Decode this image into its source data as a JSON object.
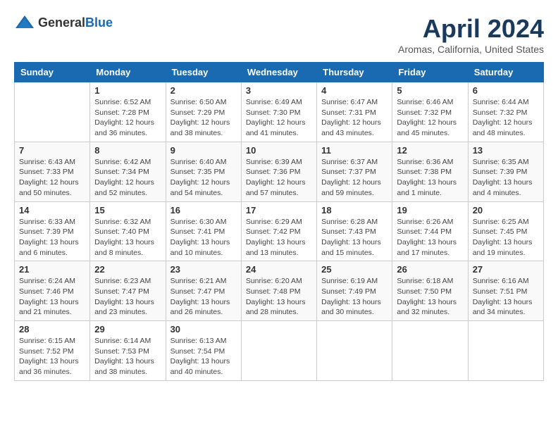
{
  "header": {
    "logo_general": "General",
    "logo_blue": "Blue",
    "month_year": "April 2024",
    "location": "Aromas, California, United States"
  },
  "weekdays": [
    "Sunday",
    "Monday",
    "Tuesday",
    "Wednesday",
    "Thursday",
    "Friday",
    "Saturday"
  ],
  "weeks": [
    [
      {
        "day": "",
        "sunrise": "",
        "sunset": "",
        "daylight": ""
      },
      {
        "day": "1",
        "sunrise": "Sunrise: 6:52 AM",
        "sunset": "Sunset: 7:28 PM",
        "daylight": "Daylight: 12 hours and 36 minutes."
      },
      {
        "day": "2",
        "sunrise": "Sunrise: 6:50 AM",
        "sunset": "Sunset: 7:29 PM",
        "daylight": "Daylight: 12 hours and 38 minutes."
      },
      {
        "day": "3",
        "sunrise": "Sunrise: 6:49 AM",
        "sunset": "Sunset: 7:30 PM",
        "daylight": "Daylight: 12 hours and 41 minutes."
      },
      {
        "day": "4",
        "sunrise": "Sunrise: 6:47 AM",
        "sunset": "Sunset: 7:31 PM",
        "daylight": "Daylight: 12 hours and 43 minutes."
      },
      {
        "day": "5",
        "sunrise": "Sunrise: 6:46 AM",
        "sunset": "Sunset: 7:32 PM",
        "daylight": "Daylight: 12 hours and 45 minutes."
      },
      {
        "day": "6",
        "sunrise": "Sunrise: 6:44 AM",
        "sunset": "Sunset: 7:32 PM",
        "daylight": "Daylight: 12 hours and 48 minutes."
      }
    ],
    [
      {
        "day": "7",
        "sunrise": "Sunrise: 6:43 AM",
        "sunset": "Sunset: 7:33 PM",
        "daylight": "Daylight: 12 hours and 50 minutes."
      },
      {
        "day": "8",
        "sunrise": "Sunrise: 6:42 AM",
        "sunset": "Sunset: 7:34 PM",
        "daylight": "Daylight: 12 hours and 52 minutes."
      },
      {
        "day": "9",
        "sunrise": "Sunrise: 6:40 AM",
        "sunset": "Sunset: 7:35 PM",
        "daylight": "Daylight: 12 hours and 54 minutes."
      },
      {
        "day": "10",
        "sunrise": "Sunrise: 6:39 AM",
        "sunset": "Sunset: 7:36 PM",
        "daylight": "Daylight: 12 hours and 57 minutes."
      },
      {
        "day": "11",
        "sunrise": "Sunrise: 6:37 AM",
        "sunset": "Sunset: 7:37 PM",
        "daylight": "Daylight: 12 hours and 59 minutes."
      },
      {
        "day": "12",
        "sunrise": "Sunrise: 6:36 AM",
        "sunset": "Sunset: 7:38 PM",
        "daylight": "Daylight: 13 hours and 1 minute."
      },
      {
        "day": "13",
        "sunrise": "Sunrise: 6:35 AM",
        "sunset": "Sunset: 7:39 PM",
        "daylight": "Daylight: 13 hours and 4 minutes."
      }
    ],
    [
      {
        "day": "14",
        "sunrise": "Sunrise: 6:33 AM",
        "sunset": "Sunset: 7:39 PM",
        "daylight": "Daylight: 13 hours and 6 minutes."
      },
      {
        "day": "15",
        "sunrise": "Sunrise: 6:32 AM",
        "sunset": "Sunset: 7:40 PM",
        "daylight": "Daylight: 13 hours and 8 minutes."
      },
      {
        "day": "16",
        "sunrise": "Sunrise: 6:30 AM",
        "sunset": "Sunset: 7:41 PM",
        "daylight": "Daylight: 13 hours and 10 minutes."
      },
      {
        "day": "17",
        "sunrise": "Sunrise: 6:29 AM",
        "sunset": "Sunset: 7:42 PM",
        "daylight": "Daylight: 13 hours and 13 minutes."
      },
      {
        "day": "18",
        "sunrise": "Sunrise: 6:28 AM",
        "sunset": "Sunset: 7:43 PM",
        "daylight": "Daylight: 13 hours and 15 minutes."
      },
      {
        "day": "19",
        "sunrise": "Sunrise: 6:26 AM",
        "sunset": "Sunset: 7:44 PM",
        "daylight": "Daylight: 13 hours and 17 minutes."
      },
      {
        "day": "20",
        "sunrise": "Sunrise: 6:25 AM",
        "sunset": "Sunset: 7:45 PM",
        "daylight": "Daylight: 13 hours and 19 minutes."
      }
    ],
    [
      {
        "day": "21",
        "sunrise": "Sunrise: 6:24 AM",
        "sunset": "Sunset: 7:46 PM",
        "daylight": "Daylight: 13 hours and 21 minutes."
      },
      {
        "day": "22",
        "sunrise": "Sunrise: 6:23 AM",
        "sunset": "Sunset: 7:47 PM",
        "daylight": "Daylight: 13 hours and 23 minutes."
      },
      {
        "day": "23",
        "sunrise": "Sunrise: 6:21 AM",
        "sunset": "Sunset: 7:47 PM",
        "daylight": "Daylight: 13 hours and 26 minutes."
      },
      {
        "day": "24",
        "sunrise": "Sunrise: 6:20 AM",
        "sunset": "Sunset: 7:48 PM",
        "daylight": "Daylight: 13 hours and 28 minutes."
      },
      {
        "day": "25",
        "sunrise": "Sunrise: 6:19 AM",
        "sunset": "Sunset: 7:49 PM",
        "daylight": "Daylight: 13 hours and 30 minutes."
      },
      {
        "day": "26",
        "sunrise": "Sunrise: 6:18 AM",
        "sunset": "Sunset: 7:50 PM",
        "daylight": "Daylight: 13 hours and 32 minutes."
      },
      {
        "day": "27",
        "sunrise": "Sunrise: 6:16 AM",
        "sunset": "Sunset: 7:51 PM",
        "daylight": "Daylight: 13 hours and 34 minutes."
      }
    ],
    [
      {
        "day": "28",
        "sunrise": "Sunrise: 6:15 AM",
        "sunset": "Sunset: 7:52 PM",
        "daylight": "Daylight: 13 hours and 36 minutes."
      },
      {
        "day": "29",
        "sunrise": "Sunrise: 6:14 AM",
        "sunset": "Sunset: 7:53 PM",
        "daylight": "Daylight: 13 hours and 38 minutes."
      },
      {
        "day": "30",
        "sunrise": "Sunrise: 6:13 AM",
        "sunset": "Sunset: 7:54 PM",
        "daylight": "Daylight: 13 hours and 40 minutes."
      },
      {
        "day": "",
        "sunrise": "",
        "sunset": "",
        "daylight": ""
      },
      {
        "day": "",
        "sunrise": "",
        "sunset": "",
        "daylight": ""
      },
      {
        "day": "",
        "sunrise": "",
        "sunset": "",
        "daylight": ""
      },
      {
        "day": "",
        "sunrise": "",
        "sunset": "",
        "daylight": ""
      }
    ]
  ]
}
